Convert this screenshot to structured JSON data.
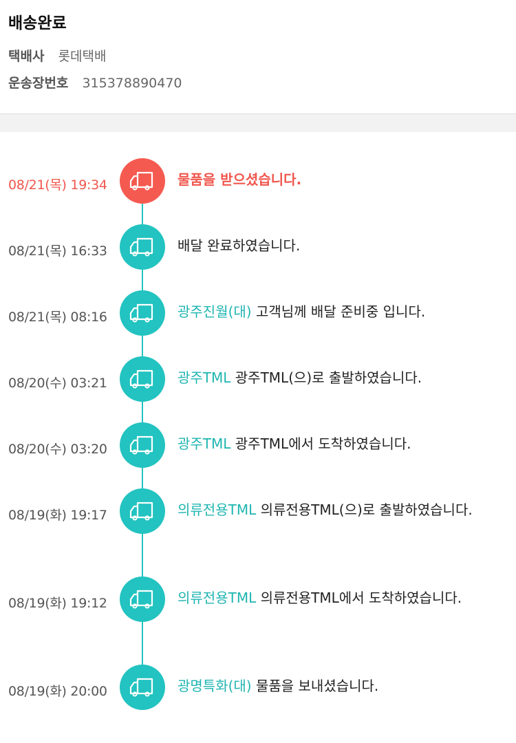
{
  "header": {
    "status_title": "배송완료",
    "courier_label": "택배사",
    "courier_value": "롯데택배",
    "tracking_label": "운송장번호",
    "tracking_value": "315378890470"
  },
  "colors": {
    "accent_teal": "#22c3c0",
    "active_red": "#f55a50"
  },
  "timeline": [
    {
      "time": "08/21(목) 19:34",
      "location": "",
      "message": "물품을 받으셨습니다.",
      "active": true,
      "icon": "truck-icon"
    },
    {
      "time": "08/21(목) 16:33",
      "location": "",
      "message": "배달 완료하였습니다.",
      "active": false,
      "icon": "truck-icon"
    },
    {
      "time": "08/21(목) 08:16",
      "location": "광주진월(대)",
      "message": " 고객님께 배달 준비중 입니다.",
      "active": false,
      "icon": "truck-icon"
    },
    {
      "time": "08/20(수) 03:21",
      "location": "광주TML",
      "message": " 광주TML(으)로 출발하였습니다.",
      "active": false,
      "icon": "truck-icon"
    },
    {
      "time": "08/20(수) 03:20",
      "location": "광주TML",
      "message": " 광주TML에서 도착하였습니다.",
      "active": false,
      "icon": "truck-icon"
    },
    {
      "time": "08/19(화) 19:17",
      "location": "의류전용TML",
      "message": " 의류전용TML(으)로 출발하였습니다.",
      "active": false,
      "icon": "truck-icon"
    },
    {
      "time": "08/19(화) 19:12",
      "location": "의류전용TML",
      "message": " 의류전용TML에서 도착하였습니다.",
      "active": false,
      "icon": "truck-icon"
    },
    {
      "time": "08/19(화) 20:00",
      "location": "광명특화(대)",
      "message": " 물품을 보내셨습니다.",
      "active": false,
      "icon": "truck-icon"
    }
  ]
}
